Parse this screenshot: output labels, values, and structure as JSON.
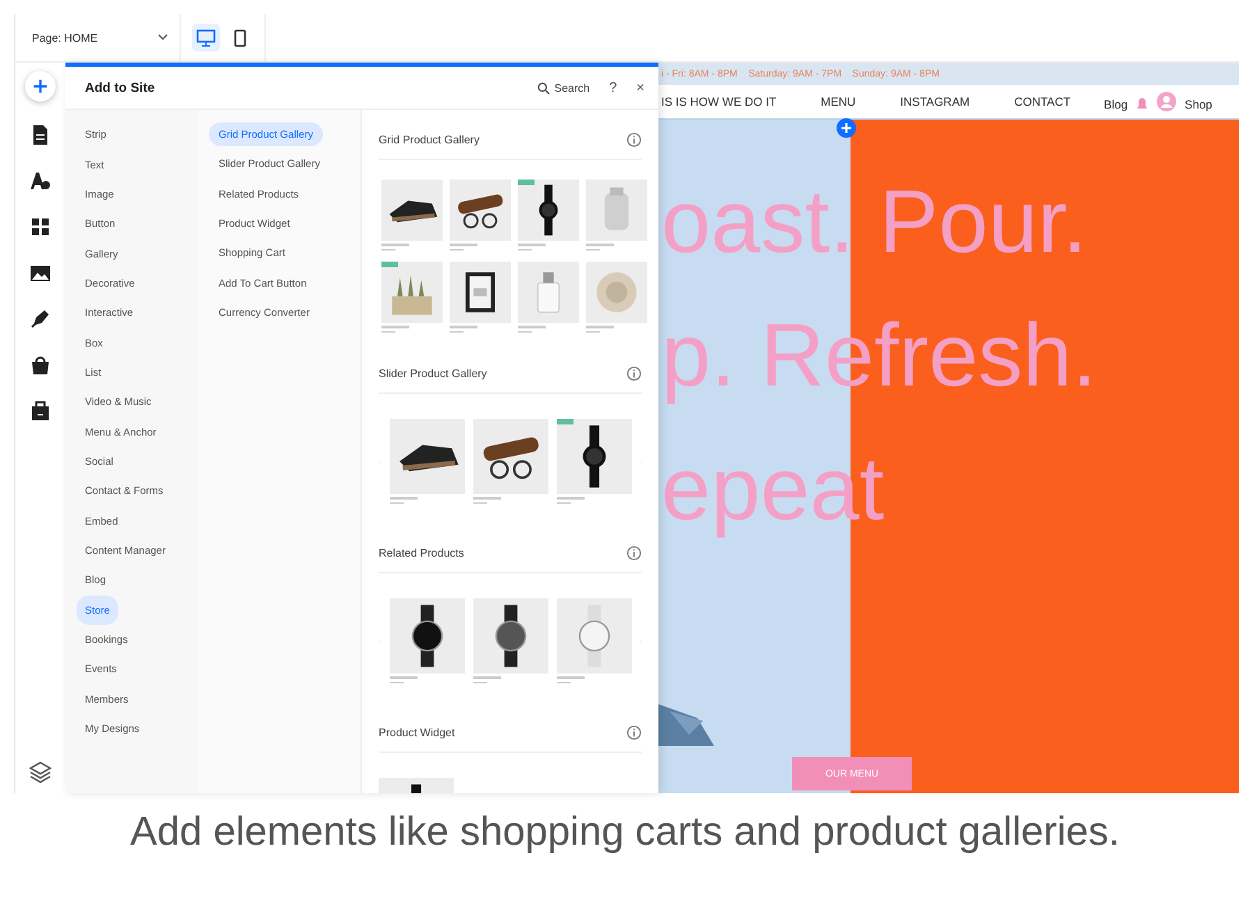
{
  "top_bar": {
    "page_select": "Page: HOME",
    "views": [
      {
        "kind": "desktop",
        "selected": true
      },
      {
        "kind": "mobile",
        "selected": false
      }
    ]
  },
  "rail": [
    {
      "kind": "add",
      "selected": true
    },
    {
      "kind": "pages",
      "selected": false
    },
    {
      "kind": "design",
      "selected": false
    },
    {
      "kind": "apps",
      "selected": false
    },
    {
      "kind": "media",
      "selected": false
    },
    {
      "kind": "pen",
      "selected": false
    },
    {
      "kind": "store",
      "selected": false
    },
    {
      "kind": "business",
      "selected": false
    },
    {
      "kind": "layers",
      "selected": false
    }
  ],
  "panel": {
    "title": "Add to Site",
    "search": "Search",
    "help": "?",
    "close": "×",
    "categories": [
      {
        "label": "Strip",
        "selected": false
      },
      {
        "label": "Text",
        "selected": false
      },
      {
        "label": "Image",
        "selected": false
      },
      {
        "label": "Button",
        "selected": false
      },
      {
        "label": "Gallery",
        "selected": false
      },
      {
        "label": "Decorative",
        "selected": false
      },
      {
        "label": "Interactive",
        "selected": false
      },
      {
        "label": "Box",
        "selected": false
      },
      {
        "label": "List",
        "selected": false
      },
      {
        "label": "Video & Music",
        "selected": false
      },
      {
        "label": "Menu & Anchor",
        "selected": false
      },
      {
        "label": "Social",
        "selected": false
      },
      {
        "label": "Contact & Forms",
        "selected": false
      },
      {
        "label": "Embed",
        "selected": false
      },
      {
        "label": "Content Manager",
        "selected": false
      },
      {
        "label": "Blog",
        "selected": false
      },
      {
        "label": "Store",
        "selected": true
      },
      {
        "label": "Bookings",
        "selected": false
      },
      {
        "label": "Events",
        "selected": false
      },
      {
        "label": "Members",
        "selected": false
      },
      {
        "label": "My Designs",
        "selected": false
      }
    ],
    "subcategories": [
      {
        "label": "Grid Product Gallery",
        "selected": true
      },
      {
        "label": "Slider Product Gallery",
        "selected": false
      },
      {
        "label": "Related Products",
        "selected": false
      },
      {
        "label": "Product Widget",
        "selected": false
      },
      {
        "label": "Shopping Cart",
        "selected": false
      },
      {
        "label": "Add To Cart Button",
        "selected": false
      },
      {
        "label": "Currency Converter",
        "selected": false
      }
    ],
    "sections": [
      {
        "title": "Grid Product Gallery",
        "kind": "grid",
        "products": [
          {
            "badge": false
          },
          {
            "badge": false
          },
          {
            "badge": true
          },
          {
            "badge": false
          },
          {
            "badge": true
          },
          {
            "badge": false
          },
          {
            "badge": false
          },
          {
            "badge": false
          }
        ]
      },
      {
        "title": "Slider Product Gallery",
        "kind": "slider",
        "products": [
          {
            "badge": false
          },
          {
            "badge": false
          },
          {
            "badge": true
          }
        ]
      },
      {
        "title": "Related Products",
        "kind": "slider",
        "products": [
          {
            "badge": false
          },
          {
            "badge": false
          },
          {
            "badge": false
          }
        ]
      },
      {
        "title": "Product Widget",
        "kind": "widget",
        "products": [
          {
            "badge": false
          }
        ]
      }
    ]
  },
  "site": {
    "hours": "i - Fri: 8AM - 8PM    Saturday: 9AM - 7PM    Sunday: 9AM - 8PM",
    "nav": [
      "IS IS HOW WE DO IT",
      "MENU",
      "INSTAGRAM",
      "CONTACT"
    ],
    "blog": "Blog",
    "shop": "Shop",
    "hero_lines": [
      "oast. Pour.",
      "p. Refresh.",
      "epeat"
    ],
    "hero_button": "OUR MENU"
  },
  "caption": "Add elements like shopping carts and product galleries."
}
